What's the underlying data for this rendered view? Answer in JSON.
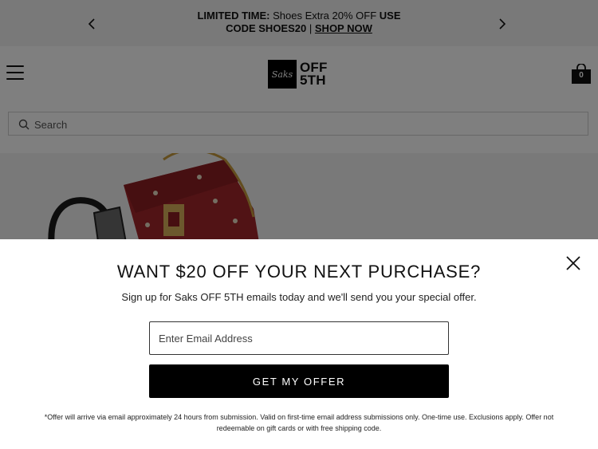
{
  "promo": {
    "limited": "LIMITED TIME:",
    "offer_text": "Shoes Extra 20% OFF",
    "use": "USE",
    "code": "CODE SHOES20",
    "separator": "|",
    "shop_now": "SHOP NOW"
  },
  "header": {
    "logo_script": "Saks",
    "logo_line1": "OFF",
    "logo_line2": "5TH",
    "bag_count": "0"
  },
  "search": {
    "placeholder": "Search"
  },
  "modal": {
    "title": "WANT $20 OFF YOUR NEXT PURCHASE?",
    "subtitle": "Sign up for Saks OFF 5TH emails today and we'll send you your special offer.",
    "email_placeholder": "Enter Email Address",
    "cta_label": "GET MY OFFER",
    "legal": "*Offer will arrive via email approximately 24 hours from submission. Valid on first-time email address submissions only. One-time use. Exclusions apply. Offer not redeemable on gift cards or with free shipping code."
  },
  "colors": {
    "banner_bg": "#f2f2f2",
    "cta_bg": "#000000",
    "bag_red": "#a3262a"
  }
}
